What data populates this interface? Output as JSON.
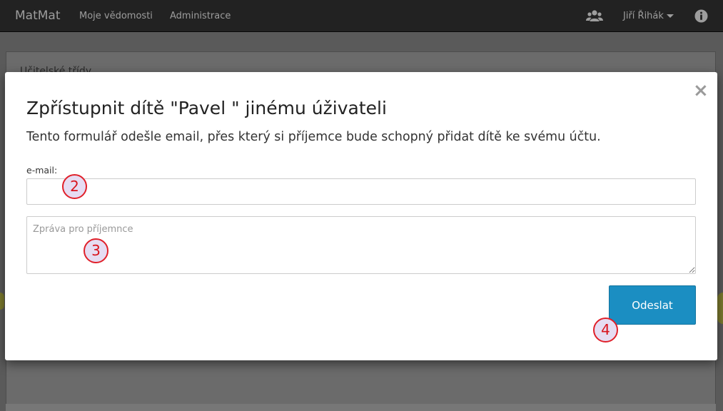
{
  "navbar": {
    "brand": "MatMat",
    "links": [
      "Moje vědomosti",
      "Administrace"
    ],
    "icons": {
      "users": "users-icon",
      "info": "info-icon"
    },
    "user_name": "Jiří Řihák"
  },
  "background": {
    "heading": "Učitelské třídy"
  },
  "modal": {
    "close_glyph": "×",
    "title": "Zpřístupnit dítě \"Pavel \" jinému úživateli",
    "description": "Tento formulář odešle email, přes který si příjemce bude schopný přidat dítě ke svému účtu.",
    "email_label": "e-mail:",
    "email_value": "",
    "message_placeholder": "Zpráva pro příjemnce",
    "message_value": "",
    "send_label": "Odeslat"
  },
  "markers": [
    "2",
    "3",
    "4"
  ],
  "colors": {
    "navbar_bg": "#222222",
    "primary_button": "#1b8ec2",
    "marker_border": "#e0202a",
    "marker_fill": "#e6dcf2"
  }
}
